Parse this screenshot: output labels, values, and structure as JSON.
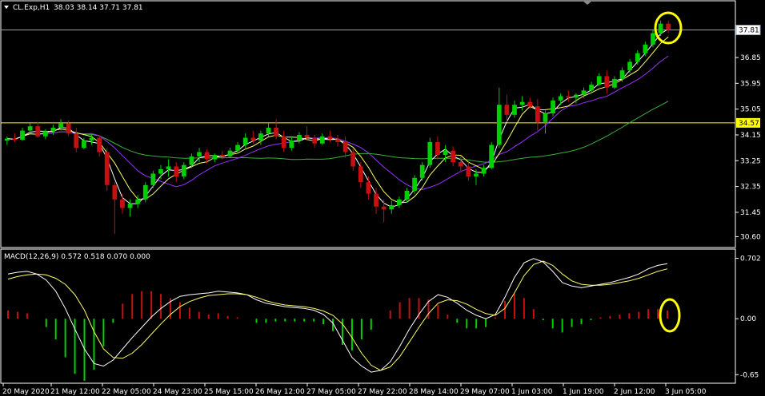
{
  "chart_data": [
    {
      "type": "candlestick",
      "symbol_header": "CL.Exp,H1",
      "ohlc_header": "38.03 38.14 37.71 37.81",
      "y_ticks": [
        "36.85",
        "35.95",
        "35.05",
        "34.15",
        "33.25",
        "32.35",
        "31.45",
        "30.60"
      ],
      "ylim": [
        30.25,
        38.8
      ],
      "current_price_label": "37.81",
      "current_price": 37.81,
      "level_line_label": "34.57",
      "level_line": 34.57,
      "ohlc": [
        [
          33.95,
          34.1,
          33.8,
          34.02
        ],
        [
          34.02,
          34.2,
          33.9,
          33.98
        ],
        [
          33.98,
          34.4,
          33.95,
          34.3
        ],
        [
          34.3,
          34.55,
          34.2,
          34.45
        ],
        [
          34.45,
          34.6,
          34.05,
          34.1
        ],
        [
          34.1,
          34.35,
          34.0,
          34.28
        ],
        [
          34.28,
          34.5,
          34.15,
          34.4
        ],
        [
          34.4,
          34.7,
          34.3,
          34.55
        ],
        [
          34.55,
          34.65,
          34.1,
          34.2
        ],
        [
          34.2,
          34.4,
          33.55,
          33.7
        ],
        [
          33.7,
          34.05,
          33.65,
          33.95
        ],
        [
          33.95,
          34.15,
          33.8,
          34.05
        ],
        [
          34.05,
          34.1,
          33.4,
          33.55
        ],
        [
          33.55,
          33.7,
          32.2,
          32.4
        ],
        [
          32.4,
          32.5,
          30.7,
          31.9
        ],
        [
          31.9,
          32.1,
          31.4,
          31.6
        ],
        [
          31.6,
          31.9,
          31.3,
          31.75
        ],
        [
          31.75,
          32.05,
          31.6,
          31.9
        ],
        [
          31.9,
          32.5,
          31.8,
          32.4
        ],
        [
          32.4,
          32.9,
          32.3,
          32.8
        ],
        [
          32.8,
          33.1,
          32.6,
          32.95
        ],
        [
          32.95,
          33.3,
          32.7,
          33.05
        ],
        [
          33.05,
          33.2,
          32.5,
          32.7
        ],
        [
          32.7,
          33.2,
          32.6,
          33.1
        ],
        [
          33.1,
          33.5,
          33.0,
          33.4
        ],
        [
          33.4,
          33.7,
          33.2,
          33.55
        ],
        [
          33.55,
          33.65,
          33.15,
          33.3
        ],
        [
          33.3,
          33.5,
          33.2,
          33.45
        ],
        [
          33.45,
          33.6,
          33.3,
          33.4
        ],
        [
          33.4,
          33.7,
          33.35,
          33.6
        ],
        [
          33.6,
          33.9,
          33.5,
          33.8
        ],
        [
          33.8,
          34.2,
          33.7,
          34.05
        ],
        [
          34.05,
          34.3,
          33.85,
          33.95
        ],
        [
          33.95,
          34.3,
          33.8,
          34.2
        ],
        [
          34.2,
          34.55,
          34.1,
          34.4
        ],
        [
          34.4,
          34.7,
          34.0,
          34.1
        ],
        [
          34.1,
          34.3,
          33.55,
          33.7
        ],
        [
          33.7,
          34.1,
          33.6,
          33.95
        ],
        [
          33.95,
          34.25,
          33.85,
          34.15
        ],
        [
          34.15,
          34.45,
          33.95,
          34.05
        ],
        [
          34.05,
          34.15,
          33.7,
          33.85
        ],
        [
          33.85,
          34.2,
          33.8,
          34.1
        ],
        [
          34.1,
          34.3,
          33.9,
          34.0
        ],
        [
          34.0,
          34.15,
          33.75,
          33.9
        ],
        [
          33.9,
          34.1,
          33.35,
          33.55
        ],
        [
          33.55,
          33.7,
          32.9,
          33.05
        ],
        [
          33.05,
          33.2,
          32.3,
          32.5
        ],
        [
          32.5,
          32.7,
          31.9,
          32.1
        ],
        [
          32.1,
          32.3,
          31.4,
          31.65
        ],
        [
          31.65,
          31.9,
          31.1,
          31.55
        ],
        [
          31.55,
          31.85,
          31.4,
          31.7
        ],
        [
          31.7,
          32.0,
          31.6,
          31.9
        ],
        [
          31.9,
          32.3,
          31.8,
          32.2
        ],
        [
          32.2,
          32.75,
          32.1,
          32.65
        ],
        [
          32.65,
          33.2,
          32.55,
          33.1
        ],
        [
          33.1,
          34.05,
          33.0,
          33.9
        ],
        [
          33.9,
          34.1,
          33.3,
          33.45
        ],
        [
          33.45,
          33.8,
          33.2,
          33.6
        ],
        [
          33.6,
          33.75,
          33.05,
          33.2
        ],
        [
          33.2,
          33.4,
          32.85,
          33.05
        ],
        [
          33.05,
          33.2,
          32.55,
          32.7
        ],
        [
          32.7,
          32.95,
          32.4,
          32.8
        ],
        [
          32.8,
          33.1,
          32.7,
          33.0
        ],
        [
          33.0,
          33.9,
          32.95,
          33.8
        ],
        [
          33.8,
          35.8,
          33.7,
          35.2
        ],
        [
          35.2,
          35.55,
          34.6,
          34.85
        ],
        [
          34.85,
          35.35,
          34.75,
          35.2
        ],
        [
          35.2,
          35.5,
          35.0,
          35.3
        ],
        [
          35.3,
          35.45,
          35.05,
          35.15
        ],
        [
          35.15,
          35.4,
          34.3,
          34.6
        ],
        [
          34.6,
          35.0,
          34.2,
          34.9
        ],
        [
          34.9,
          35.45,
          34.8,
          35.35
        ],
        [
          35.35,
          35.6,
          35.2,
          35.5
        ],
        [
          35.5,
          35.7,
          35.3,
          35.45
        ],
        [
          35.45,
          35.6,
          35.25,
          35.55
        ],
        [
          35.55,
          35.8,
          35.45,
          35.7
        ],
        [
          35.7,
          36.0,
          35.6,
          35.9
        ],
        [
          35.9,
          36.3,
          35.85,
          36.2
        ],
        [
          36.2,
          36.4,
          35.6,
          35.8
        ],
        [
          35.8,
          36.2,
          35.75,
          36.1
        ],
        [
          36.1,
          36.5,
          36.0,
          36.4
        ],
        [
          36.4,
          36.8,
          36.3,
          36.7
        ],
        [
          36.7,
          37.1,
          36.6,
          37.0
        ],
        [
          37.0,
          37.4,
          36.9,
          37.3
        ],
        [
          37.3,
          37.8,
          37.2,
          37.7
        ],
        [
          37.7,
          38.14,
          37.6,
          38.03
        ],
        [
          38.03,
          38.14,
          37.71,
          37.81
        ]
      ],
      "indicator_header": "MACD(12,26,9) 0.572 0.518 0.070 0.000",
      "indicator_y_ticks": [
        "0.702",
        "0.00",
        "-0.65"
      ],
      "indicator_ylim": [
        -0.74,
        0.8
      ],
      "macd": [
        0.52,
        0.54,
        0.55,
        0.52,
        0.45,
        0.32,
        0.12,
        -0.12,
        -0.35,
        -0.52,
        -0.55,
        -0.48,
        -0.35,
        -0.22,
        -0.1,
        0.02,
        0.12,
        0.2,
        0.26,
        0.28,
        0.29,
        0.3,
        0.32,
        0.31,
        0.3,
        0.28,
        0.22,
        0.18,
        0.16,
        0.14,
        0.13,
        0.12,
        0.1,
        0.05,
        -0.05,
        -0.25,
        -0.45,
        -0.55,
        -0.62,
        -0.6,
        -0.5,
        -0.32,
        -0.12,
        0.05,
        0.2,
        0.28,
        0.25,
        0.18,
        0.1,
        0.04,
        0.0,
        0.05,
        0.25,
        0.48,
        0.65,
        0.7,
        0.66,
        0.55,
        0.42,
        0.38,
        0.36,
        0.38,
        0.4,
        0.42,
        0.45,
        0.48,
        0.52,
        0.58,
        0.62,
        0.64
      ],
      "signal": [
        0.46,
        0.49,
        0.51,
        0.52,
        0.51,
        0.47,
        0.4,
        0.28,
        0.1,
        -0.15,
        -0.35,
        -0.45,
        -0.46,
        -0.4,
        -0.3,
        -0.18,
        -0.06,
        0.05,
        0.14,
        0.2,
        0.24,
        0.27,
        0.28,
        0.29,
        0.29,
        0.28,
        0.25,
        0.21,
        0.18,
        0.16,
        0.15,
        0.14,
        0.12,
        0.09,
        0.04,
        -0.06,
        -0.22,
        -0.4,
        -0.54,
        -0.6,
        -0.56,
        -0.44,
        -0.27,
        -0.1,
        0.06,
        0.18,
        0.22,
        0.21,
        0.17,
        0.11,
        0.06,
        0.04,
        0.12,
        0.3,
        0.5,
        0.63,
        0.67,
        0.62,
        0.52,
        0.44,
        0.4,
        0.39,
        0.39,
        0.4,
        0.42,
        0.44,
        0.47,
        0.51,
        0.55,
        0.58
      ],
      "x_labels": [
        "20 May 2020",
        "21 May 12:00",
        "22 May 05:00",
        "24 May 23:00",
        "25 May 15:00",
        "26 May 12:00",
        "27 May 05:00",
        "27 May 22:00",
        "28 May 14:00",
        "29 May 07:00",
        "1 Jun 03:00",
        "1 Jun 19:00",
        "2 Jun 12:00",
        "3 Jun 05:00"
      ]
    }
  ],
  "colors": {
    "background": "#000000",
    "bull": "#00d000",
    "bear": "#c81010",
    "ma_fast": "#ffffff",
    "ma_mid": "#ffff66",
    "ma_slow": "#9933ff",
    "ma_long": "#3ab03a",
    "level_line": "#ffff00",
    "price_line": "#8fa0c0",
    "macd_line": "#ffffff",
    "signal_line": "#ffff66",
    "highlight": "#ffff00",
    "frame": "#ffffff"
  }
}
